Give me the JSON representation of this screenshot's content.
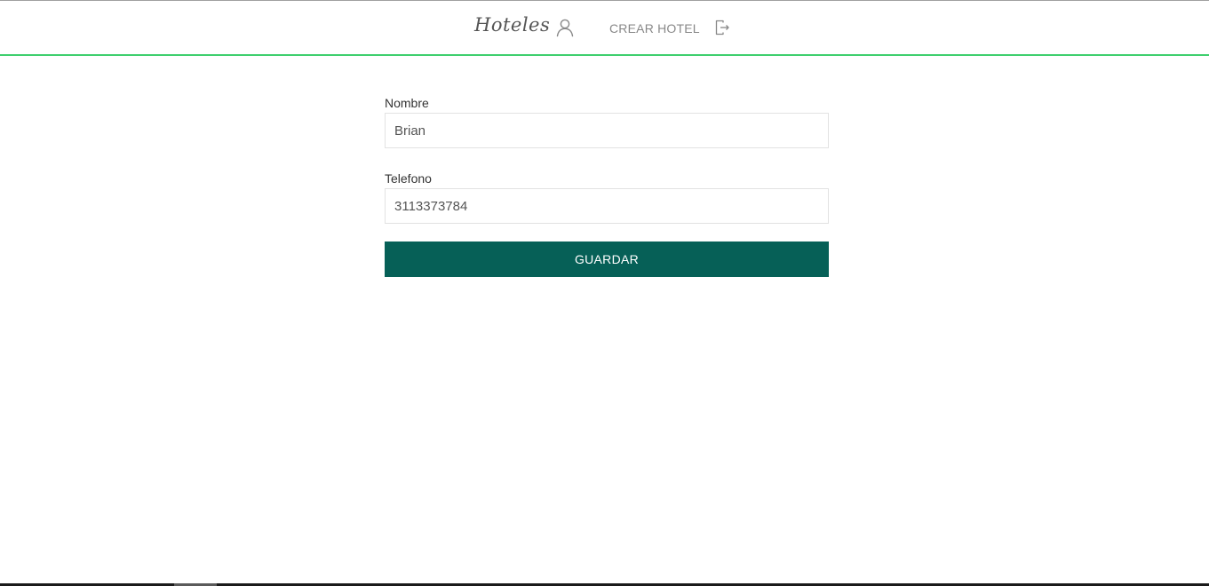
{
  "navbar": {
    "brand": "Hoteles",
    "user_icon": "user-icon",
    "create_hotel_label": "CREAR HOTEL",
    "logout_icon": "logout-icon",
    "accent_color": "#3ecf6e"
  },
  "form": {
    "name_label": "Nombre",
    "name_value": "Brian",
    "phone_label": "Telefono",
    "phone_value": "3113373784",
    "save_label": "GUARDAR",
    "button_color": "#066057"
  }
}
